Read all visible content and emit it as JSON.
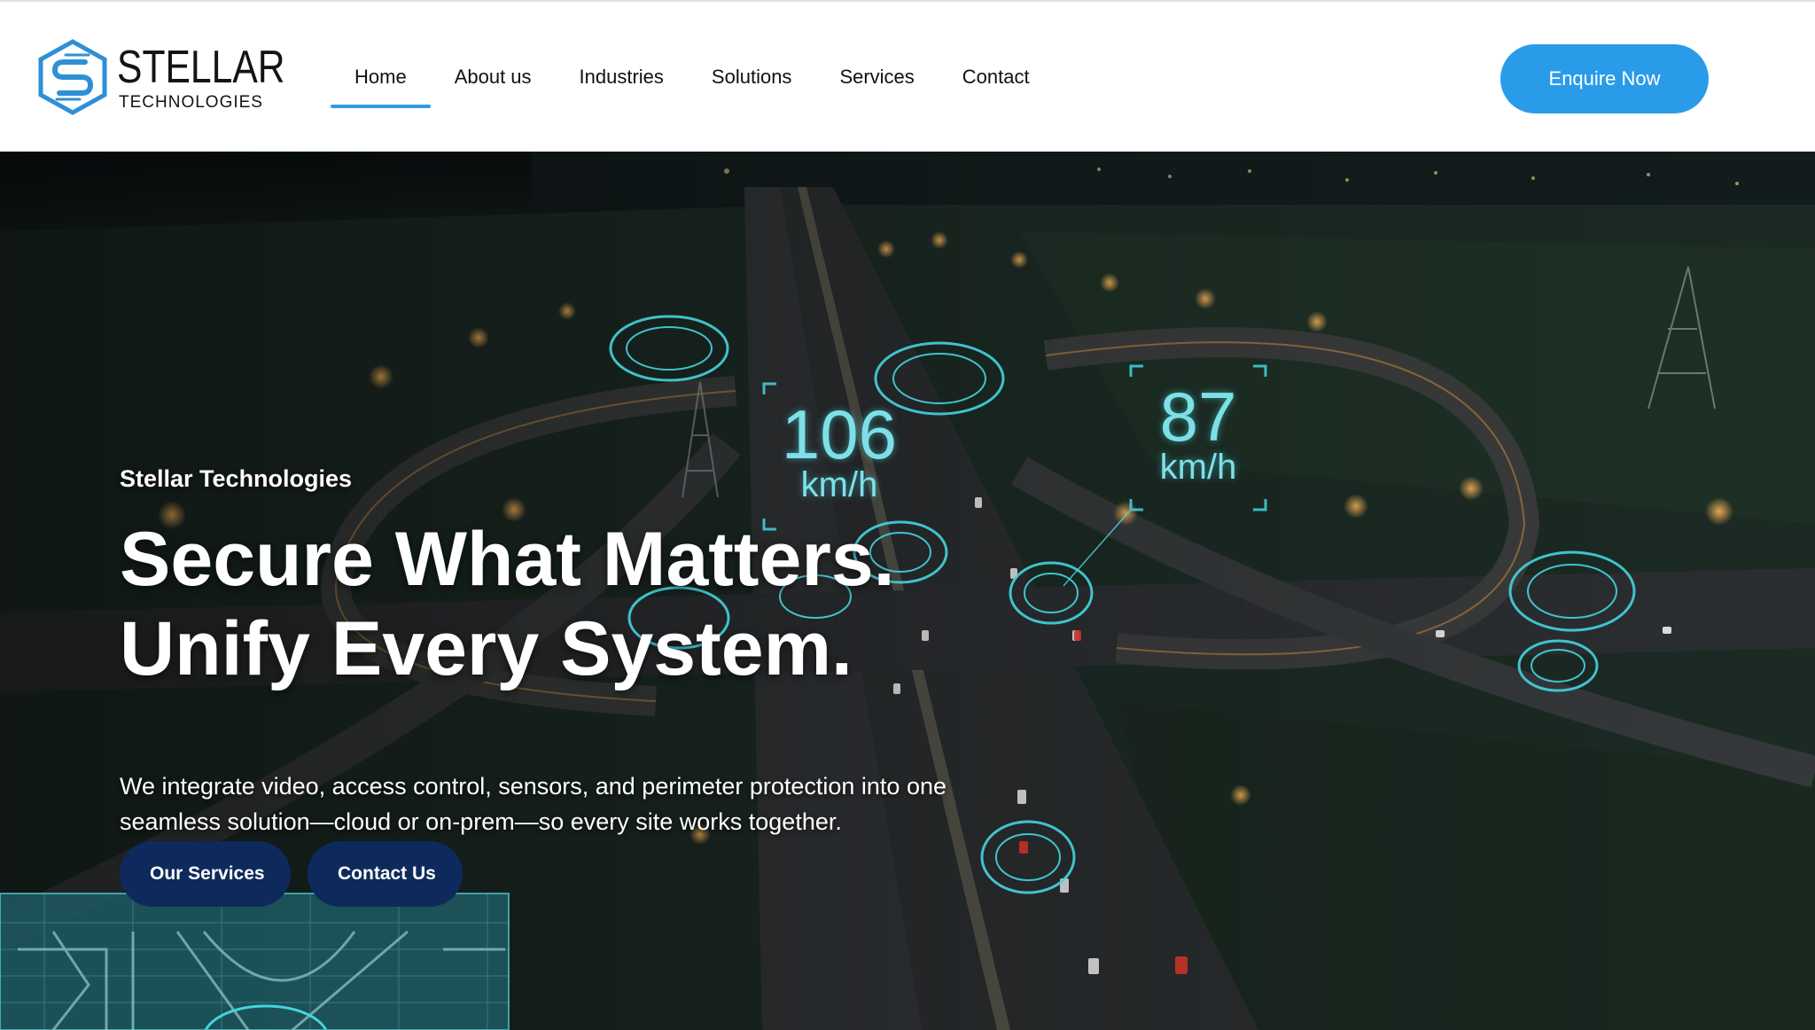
{
  "brand": {
    "name": "STELLAR",
    "tagline": "TECHNOLOGIES",
    "logo_icon": "stellar-s-hexagon-logo",
    "accent_color": "#2a9be9"
  },
  "nav": {
    "items": [
      {
        "label": "Home",
        "active": true
      },
      {
        "label": "About us",
        "active": false
      },
      {
        "label": "Industries",
        "active": false
      },
      {
        "label": "Solutions",
        "active": false
      },
      {
        "label": "Services",
        "active": false
      },
      {
        "label": "Contact",
        "active": false
      }
    ]
  },
  "header": {
    "cta_label": "Enquire Now"
  },
  "hero": {
    "kicker": "Stellar Technologies",
    "title_line1": "Secure What Matters.",
    "title_line2": "Unify Every System.",
    "description": "We integrate video, access control, sensors, and perimeter protection into one seamless solution—cloud or on-prem—so every site works together.",
    "buttons": {
      "services_label": "Our Services",
      "contact_label": "Contact Us"
    },
    "button_color": "#0e2a5c",
    "overlay": {
      "speed_1_value": "106",
      "speed_1_unit": "km/h",
      "speed_2_value": "87",
      "speed_2_unit": "km/h"
    }
  }
}
